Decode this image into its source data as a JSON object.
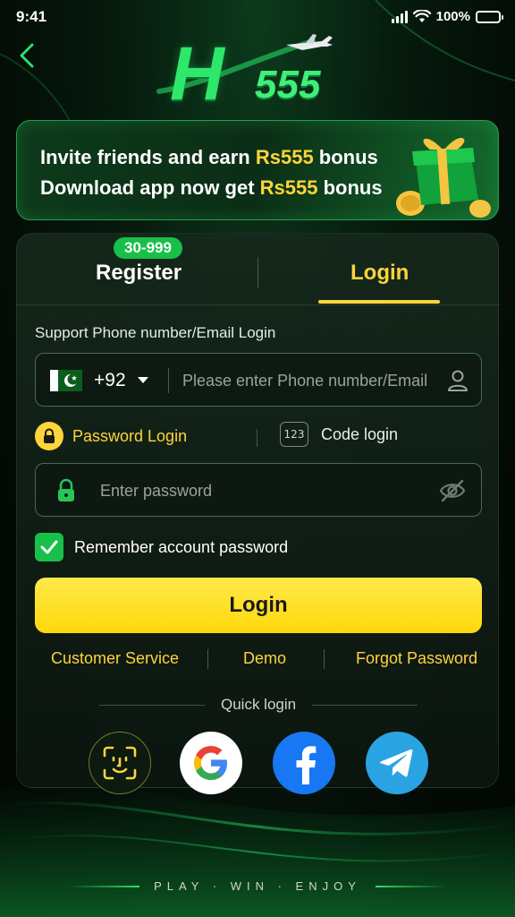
{
  "status_bar": {
    "time": "9:41",
    "battery": "100%"
  },
  "logo": {
    "letter": "H",
    "number": "555"
  },
  "banner": {
    "line1_prefix": "Invite friends and earn ",
    "line1_amount": "Rs555",
    "line1_suffix": " bonus",
    "line2_prefix": "Download app now get ",
    "line2_amount": "Rs555",
    "line2_suffix": " bonus"
  },
  "tabs": {
    "register_label": "Register",
    "register_badge": "30-999",
    "login_label": "Login",
    "active": "Login"
  },
  "form": {
    "support_text": "Support Phone number/Email Login",
    "country_code": "+92",
    "phone_placeholder": "Please enter Phone number/Email",
    "password_login_label": "Password Login",
    "code_icon_text": "123",
    "code_login_label": "Code login",
    "password_placeholder": "Enter password",
    "remember_label": "Remember account password",
    "remember_checked": true,
    "login_button": "Login"
  },
  "links": {
    "customer_service": "Customer Service",
    "demo": "Demo",
    "forgot_password": "Forgot Password"
  },
  "quick_login": {
    "title": "Quick login",
    "providers": [
      "face-id",
      "google",
      "facebook",
      "telegram"
    ]
  },
  "footer": {
    "tagline": "PLAY · WIN · ENJOY"
  },
  "colors": {
    "accent_yellow": "#ffd43b",
    "accent_green": "#18c04a",
    "background": "#061a0d"
  }
}
